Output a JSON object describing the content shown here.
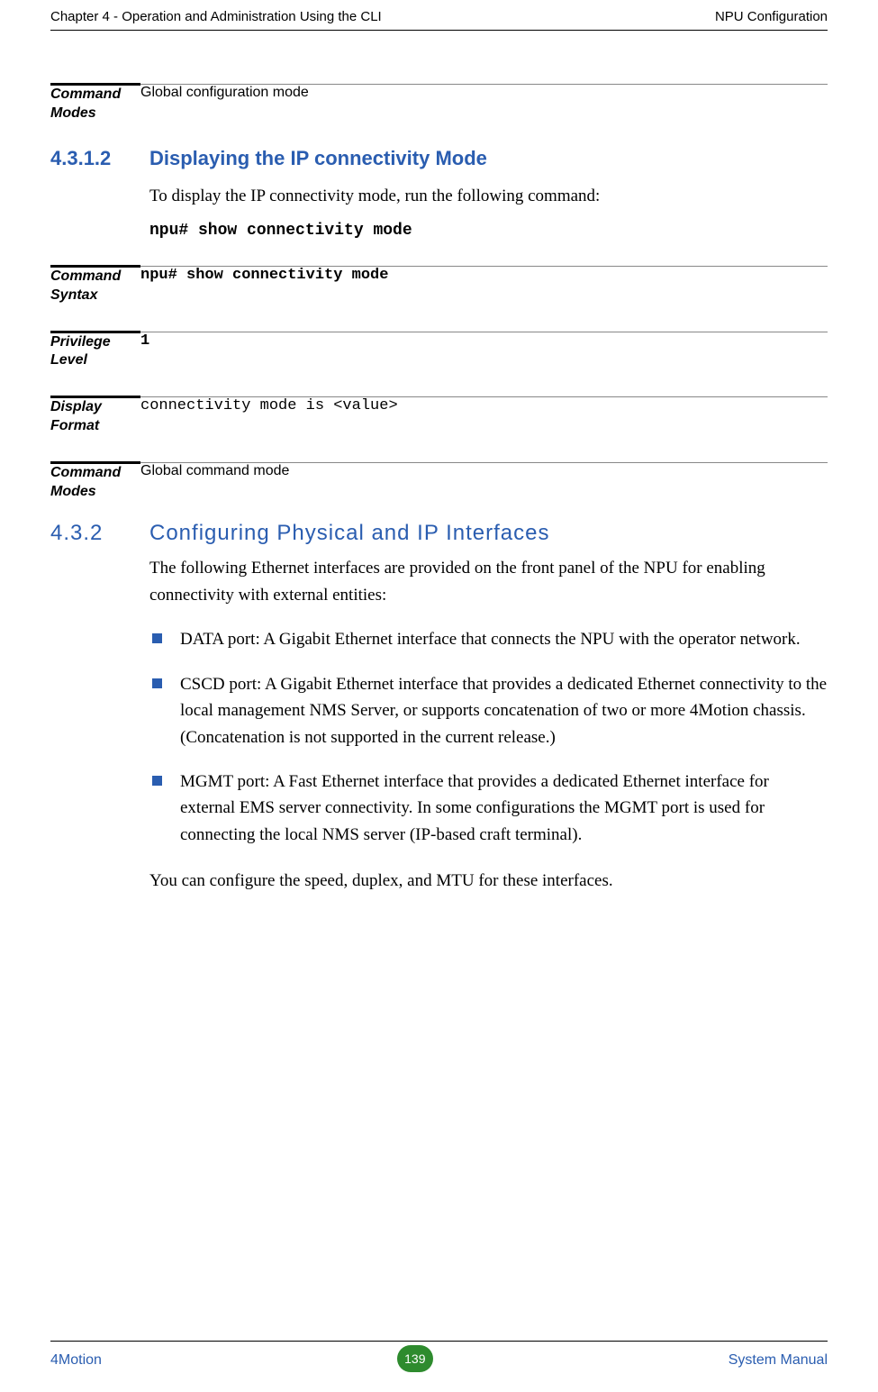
{
  "header": {
    "left": "Chapter 4 - Operation and Administration Using the CLI",
    "right": "NPU Configuration"
  },
  "blocks": {
    "cmd_modes_1": {
      "label_l1": "Command",
      "label_l2": "Modes",
      "value": "Global configuration mode"
    },
    "cmd_syntax": {
      "label_l1": "Command",
      "label_l2": "Syntax",
      "value": "npu# show connectivity mode"
    },
    "priv_level": {
      "label_l1": "Privilege",
      "label_l2": "Level",
      "value": "1"
    },
    "disp_format": {
      "label_l1": "Display",
      "label_l2": "Format",
      "value": "connectivity mode is <value>"
    },
    "cmd_modes_2": {
      "label_l1": "Command",
      "label_l2": "Modes",
      "value": "Global command mode"
    }
  },
  "section_4312": {
    "num": "4.3.1.2",
    "title": "Displaying the IP connectivity Mode",
    "para": "To display the IP connectivity mode, run the following command:",
    "cmd": "npu# show connectivity mode"
  },
  "section_432": {
    "num": "4.3.2",
    "title": "Configuring Physical and IP Interfaces",
    "para": "The following Ethernet interfaces are provided on the front panel of the NPU for enabling connectivity with external entities:",
    "bullets": [
      "DATA port: A Gigabit Ethernet interface that connects the NPU with the operator network.",
      "CSCD port: A Gigabit Ethernet interface that provides a dedicated Ethernet connectivity to the local management NMS Server, or supports concatenation of two or more 4Motion chassis. (Concatenation is not supported in the current release.)",
      "MGMT port: A Fast Ethernet interface that provides a dedicated Ethernet interface for external EMS server connectivity. In some configurations the MGMT port is used for connecting the local NMS server (IP-based craft terminal)."
    ],
    "tail": "You can configure the speed, duplex, and MTU for these interfaces."
  },
  "footer": {
    "left": "4Motion",
    "page": "139",
    "right": "System Manual"
  }
}
